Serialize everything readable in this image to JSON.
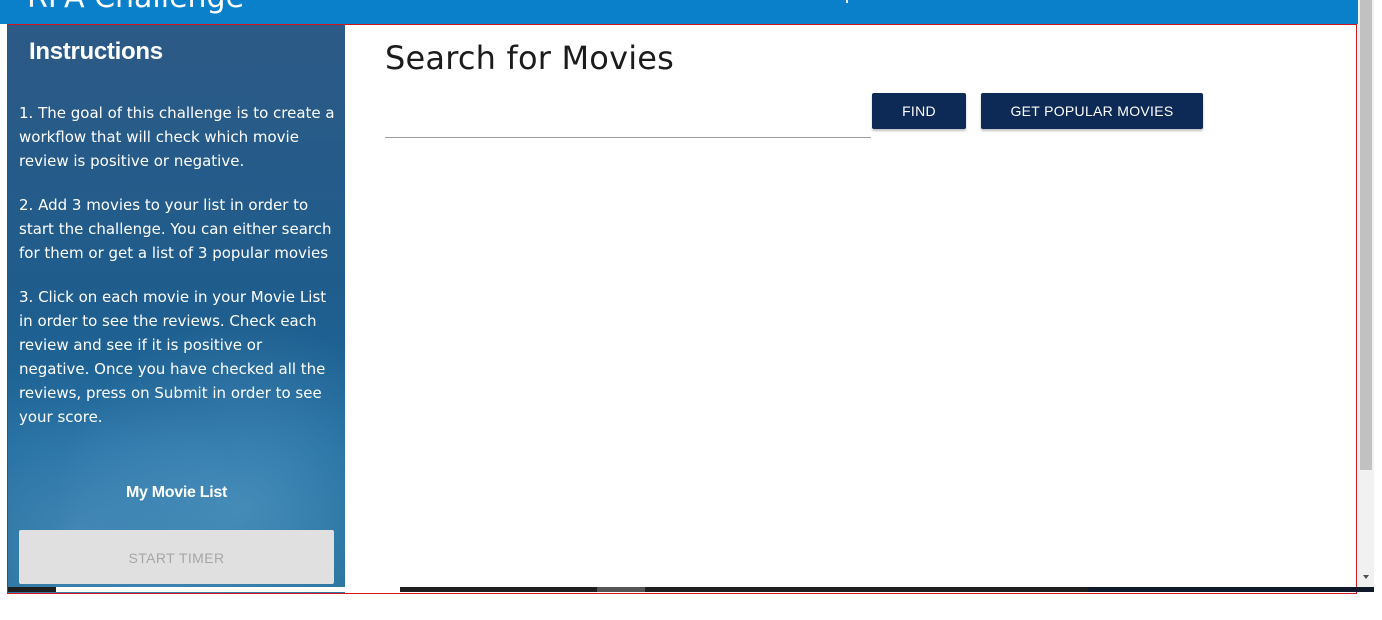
{
  "header": {
    "app_title": "RPA Challenge"
  },
  "sidebar": {
    "title": "Instructions",
    "steps": [
      "1. The goal of this challenge is to create a workflow that will check which movie review is positive or negative.",
      "2. Add 3 movies to your list in order to start the challenge. You can either search for them or get a list of 3 popular movies",
      "3. Click on each movie in your Movie List in order to see the reviews. Check each review and see if it is positive or negative. Once you have checked all the reviews, press on Submit in order to see your score."
    ],
    "movie_list_label": "My Movie List",
    "start_timer_label": "START TIMER"
  },
  "main": {
    "title": "Search for Movies",
    "search": {
      "value": "",
      "placeholder": ""
    },
    "find_label": "FIND",
    "popular_label": "GET POPULAR MOVIES"
  },
  "colors": {
    "header": "#0a7fca",
    "button": "#0c2a55",
    "frame_border": "#d2161e",
    "disabled_button": "#e0e0e0"
  }
}
